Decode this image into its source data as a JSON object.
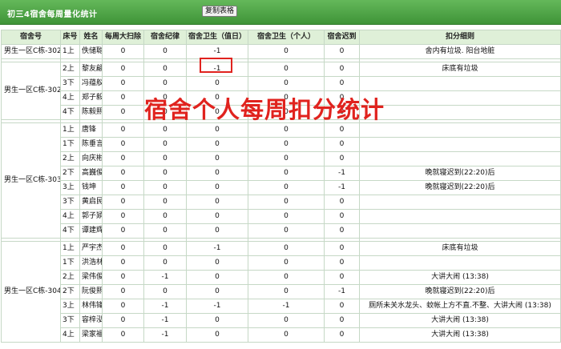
{
  "title": "初三4宿舍每周量化统计",
  "copy_button_label": "复制表格",
  "overlay_text": "宿舍个人每周扣分统计",
  "colors": {
    "title_bar": "#4fa446",
    "header_bg": "#dff0d8",
    "overlay_text": "#e0231e",
    "highlight_box": "#e0231e"
  },
  "table": {
    "headers": [
      "宿舍号",
      "床号",
      "姓名",
      "每周大扫除",
      "宿舍纪律",
      "宿舍卫生（值日）",
      "宿舍卫生（个人）",
      "宿舍迟到",
      "扣分细则"
    ],
    "groups": [
      {
        "room": "男生一区C栋-302",
        "rows": [
          [
            "1上",
            "佚储聪",
            "0",
            "0",
            "-1",
            "0",
            "0",
            "舍内有垃圾. 阳台地脏"
          ]
        ]
      },
      {
        "room": "男生一区C栋-302",
        "rows": [
          [
            "2上",
            "黎友翩",
            "0",
            "0",
            "-1",
            "0",
            "0",
            "床底有垃圾"
          ],
          [
            "3下",
            "冯蕴舣",
            "0",
            "0",
            "0",
            "0",
            "0",
            ""
          ],
          [
            "4上",
            "郑子毅",
            "0",
            "0",
            "0",
            "0",
            "0",
            ""
          ],
          [
            "4下",
            "陈毅熙",
            "0",
            "0",
            "0",
            "0",
            "0",
            ""
          ]
        ]
      },
      {
        "room": "男生一区C栋-303",
        "rows": [
          [
            "1上",
            "唐锋",
            "0",
            "0",
            "0",
            "0",
            "0",
            ""
          ],
          [
            "1下",
            "陈垂言",
            "0",
            "0",
            "0",
            "0",
            "0",
            ""
          ],
          [
            "2上",
            "向庆彬",
            "0",
            "0",
            "0",
            "0",
            "0",
            ""
          ],
          [
            "2下",
            "高巍俊",
            "0",
            "0",
            "0",
            "0",
            "-1",
            "晚就寝迟到(22:20)后"
          ],
          [
            "3上",
            "钱坤",
            "0",
            "0",
            "0",
            "0",
            "-1",
            "晚就寝迟到(22:20)后"
          ],
          [
            "3下",
            "黄启民",
            "0",
            "0",
            "0",
            "0",
            "0",
            ""
          ],
          [
            "4上",
            "郭子熲",
            "0",
            "0",
            "0",
            "0",
            "0",
            ""
          ],
          [
            "4下",
            "谭建辉",
            "0",
            "0",
            "0",
            "0",
            "0",
            ""
          ]
        ]
      },
      {
        "room": "男生一区C栋-304",
        "rows": [
          [
            "1上",
            "严宇杰",
            "0",
            "0",
            "-1",
            "0",
            "0",
            "床底有垃圾"
          ],
          [
            "1下",
            "洪浩林",
            "0",
            "0",
            "0",
            "0",
            "0",
            ""
          ],
          [
            "2上",
            "梁伟俊",
            "0",
            "-1",
            "0",
            "0",
            "0",
            "大讲大闹 (13:38)"
          ],
          [
            "2下",
            "阮俊熙",
            "0",
            "0",
            "0",
            "0",
            "-1",
            "晚就寝迟到(22:20)后"
          ],
          [
            "3上",
            "林伟锋",
            "0",
            "-1",
            "-1",
            "-1",
            "0",
            "厕所未关水龙头、蚊帐上方不直.不整、大讲大闹 (13:38)"
          ],
          [
            "3下",
            "容梓泓",
            "0",
            "-1",
            "0",
            "0",
            "0",
            "大讲大闹 (13:38)"
          ],
          [
            "4上",
            "梁家福",
            "0",
            "-1",
            "0",
            "0",
            "0",
            "大讲大闹 (13:38)"
          ]
        ]
      }
    ]
  }
}
